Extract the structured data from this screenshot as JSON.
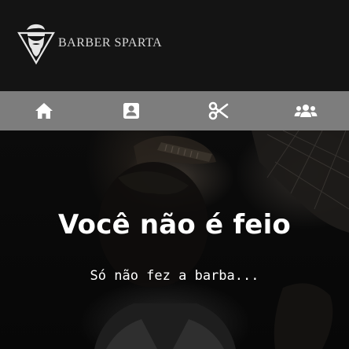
{
  "brand": {
    "name": "BARBER SPARTA",
    "logo_icon": "bearded-man-triangle-logo"
  },
  "nav": {
    "items": [
      {
        "icon": "home-icon",
        "label": ""
      },
      {
        "icon": "contact-card-icon",
        "label": ""
      },
      {
        "icon": "scissors-icon",
        "label": ""
      },
      {
        "icon": "users-group-icon",
        "label": ""
      }
    ],
    "background_color": "#7d7d7d"
  },
  "hero": {
    "headline": "Você não é feio",
    "subline": "Só não fez a barba..."
  },
  "colors": {
    "header_bg": "#141414",
    "text": "#ffffff",
    "brand_text": "#d8d8d8"
  }
}
